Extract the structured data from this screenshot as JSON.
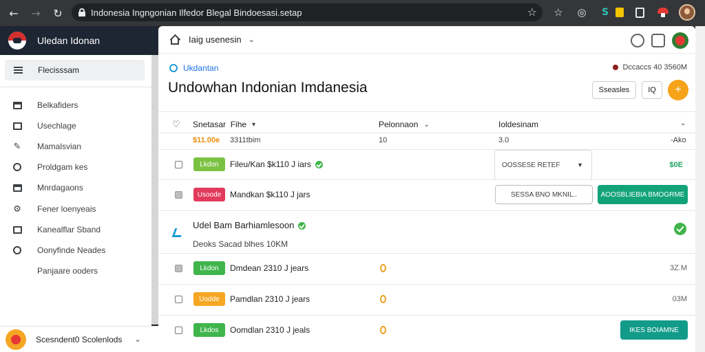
{
  "browser": {
    "url": "Indonesia Ingngonian Ilfedor Blegal Bindoesasi.setap"
  },
  "app": {
    "name": "Uledan Idonan"
  },
  "sidebar": {
    "active_item": "Flecisssam",
    "items": [
      {
        "label": "Belkafiders",
        "icon": "folder-icon"
      },
      {
        "label": "Usechlage",
        "icon": "list-box-icon"
      },
      {
        "label": "Mamalsvian",
        "icon": "pen-icon"
      },
      {
        "label": "Proldgam kes",
        "icon": "pin-icon"
      },
      {
        "label": "Mnrdagaons",
        "icon": "file-icon"
      },
      {
        "label": "Fener loenyeais",
        "icon": "gear-icon"
      },
      {
        "label": "Kanealflar Sband",
        "icon": "card-icon"
      },
      {
        "label": "Oonyfinde Neades",
        "icon": "check-circle-icon"
      },
      {
        "label": "Panjaare ooders",
        "icon": ""
      }
    ],
    "footer_user": "Scesndent0 Scolenlods"
  },
  "toolbar": {
    "label": "Iaig usenesin"
  },
  "page": {
    "breadcrumb": "Ukdantan",
    "status": "Dccaccs 40 3560M",
    "title": "Undowhan Indonian Imdanesia",
    "button_secondary": "Sseasles",
    "button_icon": "IQ",
    "fab_symbol": "+"
  },
  "table": {
    "columns": [
      "Snetasar",
      "Fihe",
      "Pelonnaon",
      "Ioldesinam"
    ],
    "subheader": {
      "price": "$11.00e",
      "price_note": "3311tbim",
      "c2": "10",
      "c3": "3.0",
      "c4": "-Ako"
    },
    "rows": [
      {
        "tag": "Lkdon",
        "tag_color": "#7cc242",
        "label": "Fileu/Kan $k110 J iars",
        "select": "OOSSESE RETEF",
        "value": "$0E"
      },
      {
        "tag": "Usoode",
        "tag_color": "#e23a5a",
        "label": "Mandkan $k110 J jars",
        "outline_button": "SESSA BNO MKNIL..",
        "primary_button": "AOOSBLIEBIA BMOGRME"
      }
    ]
  },
  "group": {
    "title": "Udel Bam Barhiamlesoon",
    "subtitle": "Deoks Sacad blhes   10KM",
    "rows": [
      {
        "tag": "Lkdon",
        "tag_color": "#3fb54b",
        "label": "Dmdean 2310 J jears",
        "coin": "0",
        "value": "3Z.M"
      },
      {
        "tag": "Uodde",
        "tag_color": "#f5a623",
        "label": "Pamdlan 2310 J jears",
        "coin": "0",
        "value": "03M"
      },
      {
        "tag": "Lkdos",
        "tag_color": "#3fb54b",
        "label": "Oomdlan 2310 J jeals",
        "coin": "0",
        "button": "IKES BOIAMNE"
      }
    ]
  }
}
